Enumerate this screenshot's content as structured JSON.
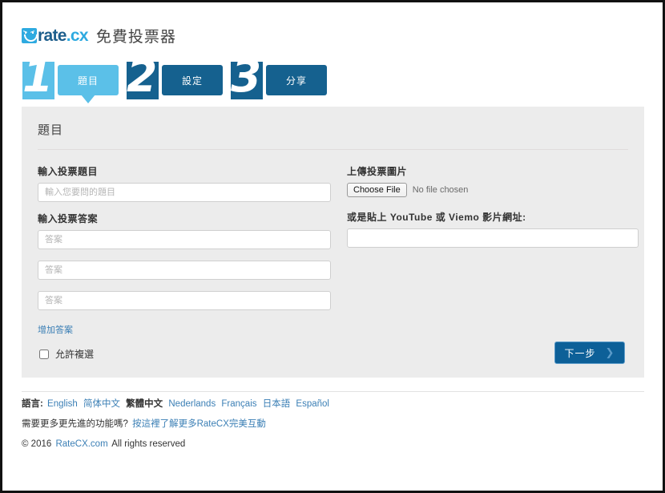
{
  "brand": {
    "logo_icon": "smiley-square-icon",
    "name_primary": "rate",
    "name_suffix": ".cx",
    "tagline": "免費投票器",
    "accent_light": "#5bc0e8",
    "accent_dark": "#15618f",
    "link_color": "#3b7fb5"
  },
  "steps": [
    {
      "number": "1",
      "label": "題目",
      "state": "active"
    },
    {
      "number": "2",
      "label": "設定",
      "state": "idle"
    },
    {
      "number": "3",
      "label": "分享",
      "state": "idle"
    }
  ],
  "panel": {
    "title": "題目",
    "left": {
      "question_label": "輸入投票題目",
      "question_placeholder": "輸入您要問的題目",
      "question_value": "",
      "answers_label": "輸入投票答案",
      "answer_placeholder": "答案",
      "answers": [
        "",
        "",
        ""
      ],
      "add_answer_link": "增加答案",
      "multi_select_label": "允許複選",
      "multi_select_checked": false
    },
    "right": {
      "upload_label": "上傳投票圖片",
      "file_button": "Choose File",
      "file_status": "No file chosen",
      "video_label": "或是貼上 YouTube 或 Viemo 影片網址:",
      "video_placeholder": "",
      "video_value": ""
    },
    "next_button": "下一步",
    "next_chevron": "chevron-right-icon"
  },
  "footer": {
    "language_label": "語言:",
    "languages": [
      {
        "name": "English",
        "current": false
      },
      {
        "name": "简体中文",
        "current": false
      },
      {
        "name": "繁體中文",
        "current": true
      },
      {
        "name": "Nederlands",
        "current": false
      },
      {
        "name": "Français",
        "current": false
      },
      {
        "name": "日本語",
        "current": false
      },
      {
        "name": "Español",
        "current": false
      }
    ],
    "promo_text": "需要更多更先進的功能嗎?",
    "promo_link": "按這裡了解更多RateCX完美互動",
    "copyright_prefix": "© 2016",
    "copyright_link": "RateCX.com",
    "copyright_suffix": "All rights reserved"
  }
}
